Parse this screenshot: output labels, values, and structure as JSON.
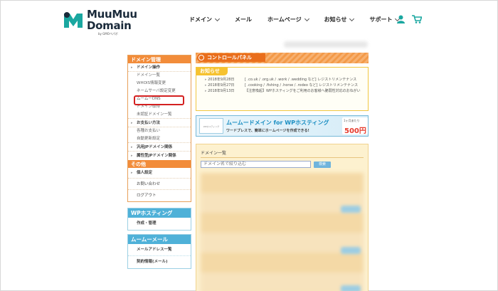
{
  "header": {
    "logo_line1": "MuuMuu",
    "logo_line2": "Domain",
    "logo_sub": "by GMOペパボ",
    "nav": [
      {
        "label": "ドメイン",
        "has_dropdown": true
      },
      {
        "label": "メール",
        "has_dropdown": false
      },
      {
        "label": "ホームページ",
        "has_dropdown": true
      },
      {
        "label": "お知らせ",
        "has_dropdown": true
      },
      {
        "label": "サポート",
        "has_dropdown": true
      }
    ],
    "icons": [
      "user-icon",
      "cart-icon"
    ],
    "accent": "#1aa7a0"
  },
  "sidebar": {
    "domain_section": {
      "title": "ドメイン管理",
      "groups": [
        {
          "label": "ドメイン操作",
          "items": [
            "ドメイン一覧",
            "WHOIS情報変更",
            "ネームサーバ設定変更",
            "ムームーDNS",
            "ドメイン取得",
            "未認証ドメイン一覧"
          ]
        },
        {
          "label": "お支払い方法",
          "items": [
            "各種お支払い",
            "自動更新設定"
          ]
        },
        {
          "label": "汎用JPドメイン関係",
          "items": []
        },
        {
          "label": "属性型JPドメイン関係",
          "items": []
        }
      ]
    },
    "other_section": {
      "title": "その他",
      "items": [
        "個人設定",
        "お問い合わせ",
        "ログアウト"
      ]
    },
    "wp_section": {
      "title": "WPホスティング",
      "items": [
        "作成・管理"
      ]
    },
    "mail_section": {
      "title": "ムームーメール",
      "items": [
        "メールアドレス一覧",
        "契約情報(メール)"
      ]
    },
    "highlighted_item": "ネームサーバ設定変更",
    "highlight_color": "#d42020"
  },
  "main": {
    "panel_title": "コントロールパネル",
    "notice": {
      "title": "お知らせ",
      "items": [
        {
          "date": "2018年9月28日",
          "text": "[ .co.uk / .org.uk / .work / .wedding など] レジストリメンテナンス"
        },
        {
          "date": "2018年9月27日",
          "text": "[ .cooking / .fishing / .horse / .rodeo など] レジストリメンテナンス"
        },
        {
          "date": "2018年9月13日",
          "text": "【注意喚起】WPホスティングをご利用のお客様へ脆弱性対応のおねがい"
        }
      ]
    },
    "banner": {
      "title": "ムームードメイン for WPホスティング",
      "subtitle": "ワードプレスで、簡単にホームページを作成できる!",
      "price_label": "1ヶ月あたり",
      "price": "500円",
      "image_alt": "WPホスティング"
    },
    "domain_list": {
      "title": "ドメイン一覧",
      "search_placeholder": "ドメイン名で絞り込む",
      "search_button": "検索"
    }
  }
}
